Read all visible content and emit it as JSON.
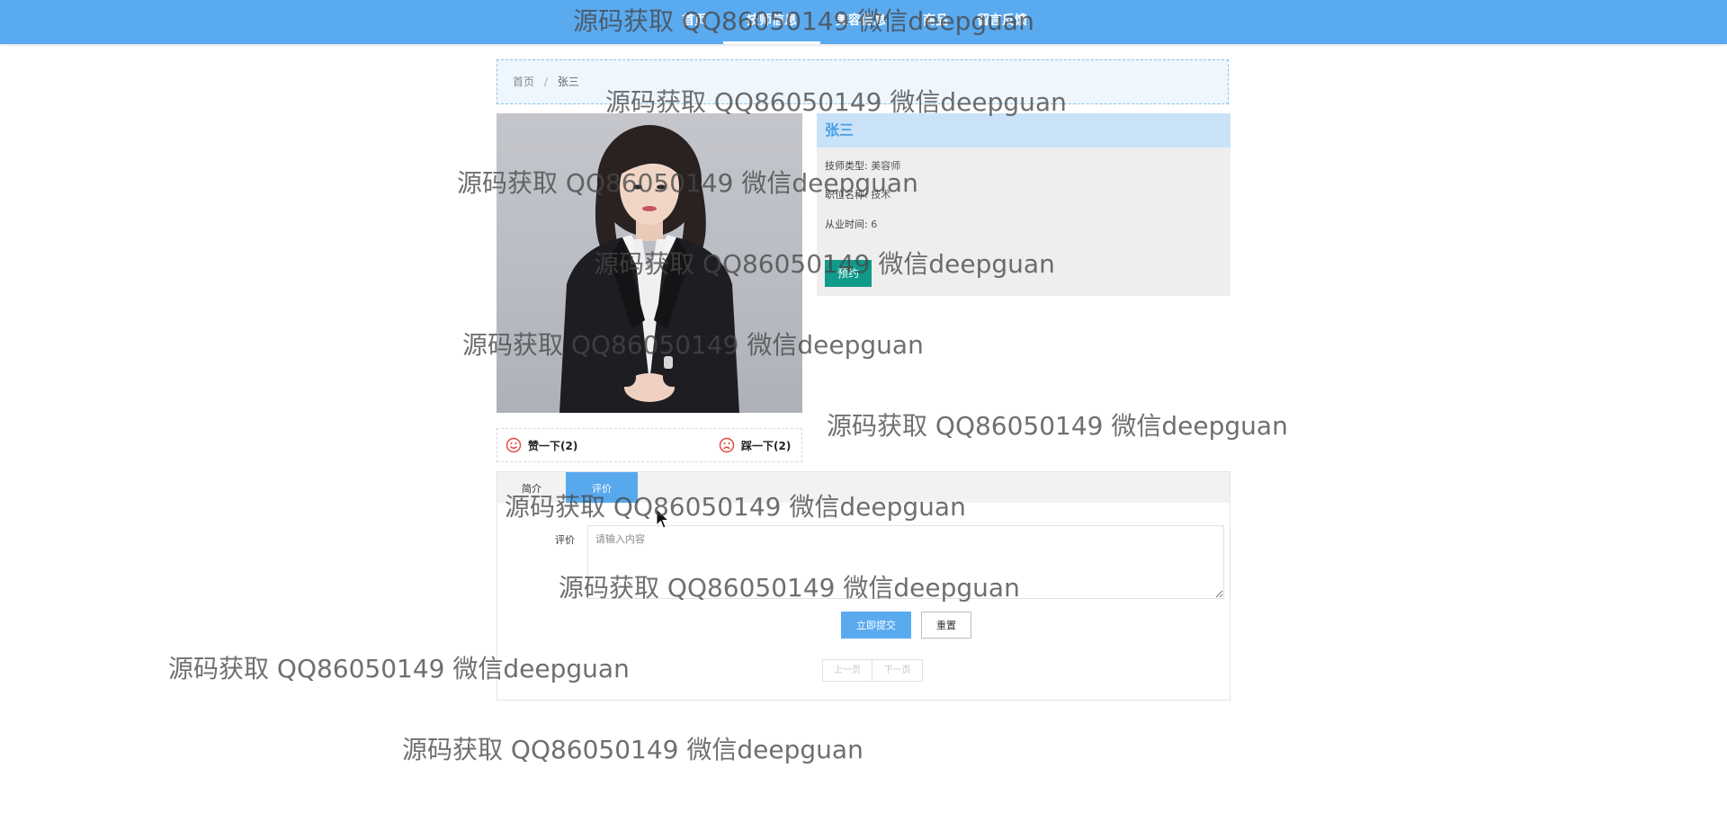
{
  "nav": {
    "items": [
      {
        "label": "首页"
      },
      {
        "label": "技师信息"
      },
      {
        "label": "美容信息"
      },
      {
        "label": "商品"
      },
      {
        "label": "留言反馈"
      }
    ]
  },
  "breadcrumb": {
    "home": "首页",
    "separator": "/",
    "current": "张三"
  },
  "profile": {
    "name": "张三",
    "type_label": "技师类型:",
    "type_value": "美容师",
    "position_label": "职位名称:",
    "position_value": "技术",
    "years_label": "从业时间:",
    "years_value": "6",
    "book_label": "预约"
  },
  "votes": {
    "like_label": "赞一下(2)",
    "dislike_label": "踩一下(2)"
  },
  "tabs": [
    {
      "label": "简介"
    },
    {
      "label": "评价"
    }
  ],
  "comment_form": {
    "label": "评价",
    "placeholder": "请输入内容",
    "submit_label": "立即提交",
    "reset_label": "重置"
  },
  "pager": {
    "prev_label": "上一页",
    "next_label": "下一页"
  },
  "watermark": "源码获取 QQ86050149 微信deepguan",
  "colors": {
    "header": "#5aaaf0",
    "accent_teal": "#0f9a8a",
    "info_header_bg": "#c9e2f8"
  }
}
